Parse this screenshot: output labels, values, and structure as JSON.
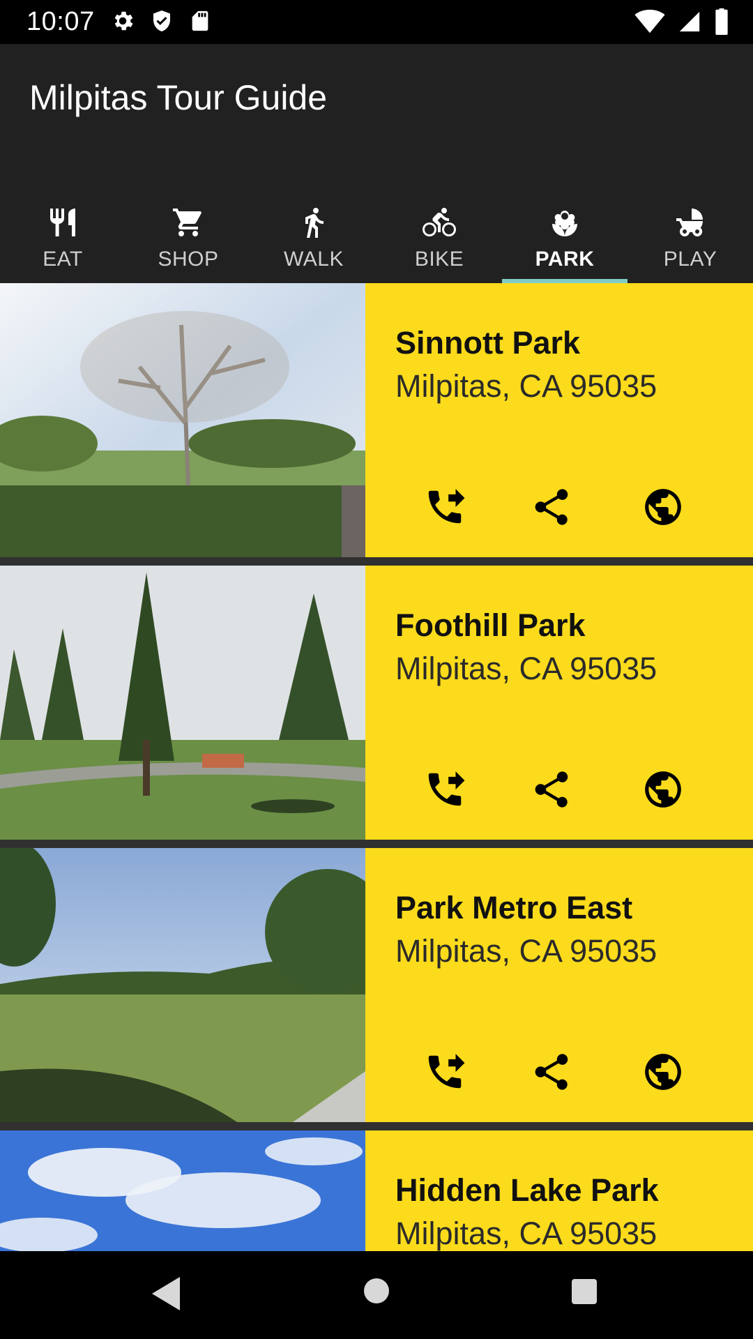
{
  "status_bar": {
    "time": "10:07",
    "left_icons": [
      "gear-icon",
      "shield-icon",
      "sd-card-icon"
    ],
    "right_icons": [
      "wifi-icon",
      "signal-icon",
      "battery-icon"
    ]
  },
  "app_bar": {
    "title": "Milpitas Tour Guide"
  },
  "tabs": [
    {
      "label": "EAT",
      "icon": "fork-knife-icon",
      "active": false
    },
    {
      "label": "SHOP",
      "icon": "cart-icon",
      "active": false
    },
    {
      "label": "WALK",
      "icon": "walk-icon",
      "active": false
    },
    {
      "label": "BIKE",
      "icon": "bike-icon",
      "active": false
    },
    {
      "label": "PARK",
      "icon": "flower-icon",
      "active": true
    },
    {
      "label": "PLAY",
      "icon": "stroller-icon",
      "active": false
    }
  ],
  "places": [
    {
      "name": "Sinnott Park",
      "address": "Milpitas, CA 95035"
    },
    {
      "name": "Foothill Park",
      "address": "Milpitas, CA 95035"
    },
    {
      "name": "Park Metro East",
      "address": "Milpitas, CA 95035"
    },
    {
      "name": "Hidden Lake Park",
      "address": "Milpitas, CA 95035"
    }
  ],
  "card_actions": [
    "phone-icon",
    "share-icon",
    "globe-icon"
  ],
  "colors": {
    "app_bar": "#212121",
    "card_accent": "#fbdb1b",
    "tab_indicator": "#80cbc4",
    "list_background": "#303030"
  },
  "nav_bar": [
    "back-button",
    "home-button",
    "recents-button"
  ]
}
